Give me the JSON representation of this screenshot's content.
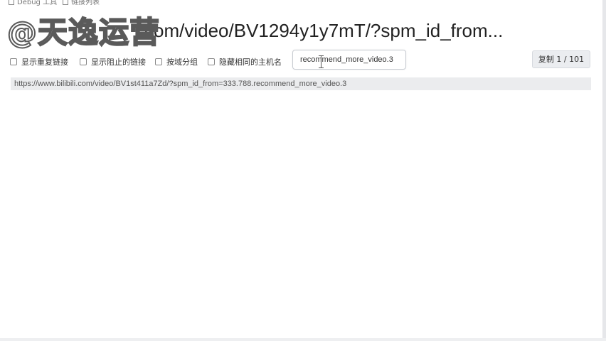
{
  "top_strip": {
    "item1": "Debug 工具",
    "item2": "链接列表"
  },
  "watermark": "@天逸运营",
  "page_title_url": "com/video/BV1294y1y7mT/?spm_id_from...",
  "options": [
    {
      "label": "显示重复链接"
    },
    {
      "label": "显示阻止的链接"
    },
    {
      "label": "按域分组"
    },
    {
      "label": "隐藏相同的主机名"
    }
  ],
  "filter": {
    "value": "recommend_more_video.3"
  },
  "copy_button": {
    "label": "复制 1 / 101"
  },
  "results": [
    {
      "url": "https://www.bilibili.com/video/BV1st411a7Zd/?spm_id_from=333.788.recommend_more_video.3"
    }
  ]
}
